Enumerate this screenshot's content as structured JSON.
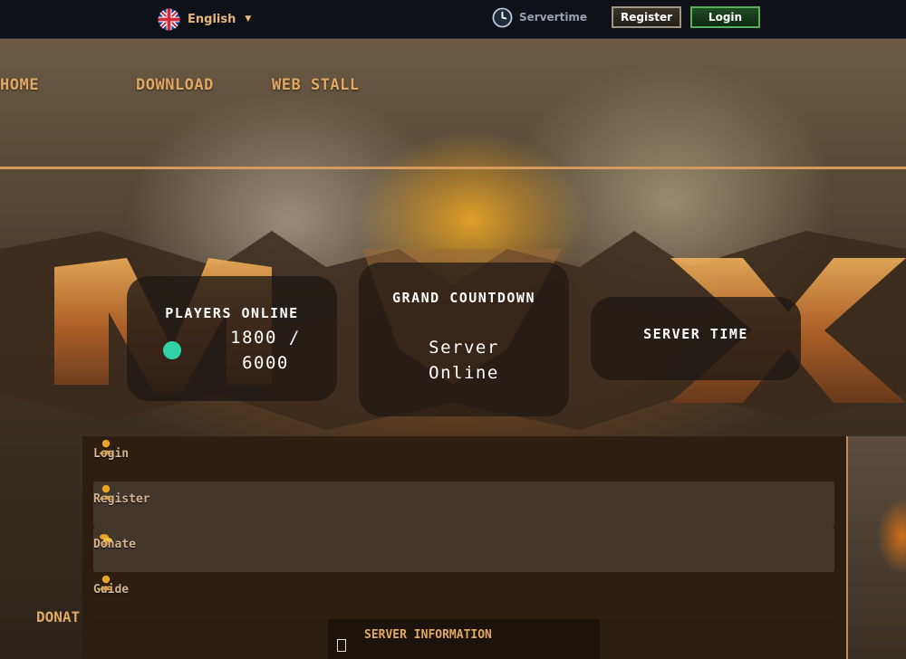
{
  "topbar": {
    "language": {
      "label": "English",
      "flag_icon": "uk-flag-icon"
    },
    "servertime_label": "Servertime",
    "register_label": "Register",
    "login_label": "Login"
  },
  "nav": {
    "items": [
      {
        "label": "HOME"
      },
      {
        "label": "DOWNLOAD"
      },
      {
        "label": "WEB STALL"
      }
    ]
  },
  "stats": {
    "players": {
      "title": "PLAYERS ONLINE",
      "value": "1800 / 6000",
      "status_color": "#33d3a8"
    },
    "countdown": {
      "title": "GRAND COUNTDOWN",
      "value": "Server Online"
    },
    "server_time": {
      "title": "SERVER TIME"
    }
  },
  "quick_links": [
    {
      "label": "Login",
      "icon": "user-icon"
    },
    {
      "label": "Register",
      "icon": "user-icon"
    },
    {
      "label": "Donate",
      "icon": "coins-icon"
    },
    {
      "label": "Guide",
      "icon": "user-icon"
    }
  ],
  "donate_partial_label": "DONAT",
  "server_information": {
    "title": "SERVER INFORMATION"
  },
  "colors": {
    "accent": "#e1a864",
    "topbar_bg": "#0e1117",
    "login_green": "#58b05a",
    "panel_bg": "#2b1e10"
  }
}
